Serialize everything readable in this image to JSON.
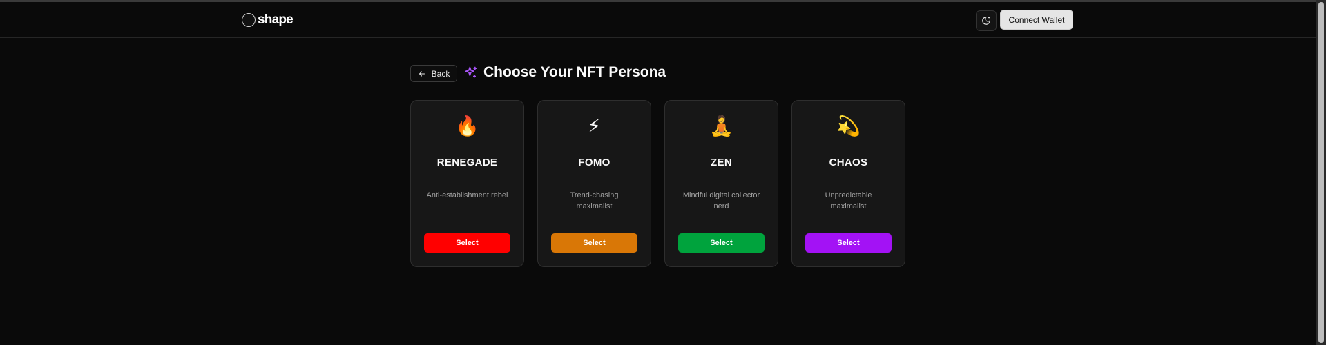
{
  "header": {
    "logo_text": "shape",
    "theme_toggle_icon": "moon-sun-icon",
    "connect_label": "Connect Wallet"
  },
  "nav": {
    "back_label": "Back",
    "back_icon": "arrow-left-icon"
  },
  "page": {
    "title_icon": "sparkles-icon",
    "title": "Choose Your NFT Persona"
  },
  "personas": [
    {
      "emoji": "🔥",
      "name": "RENEGADE",
      "description": "Anti-establishment rebel",
      "button_label": "Select",
      "color": "#ff0000"
    },
    {
      "emoji": "⚡",
      "name": "FOMO",
      "description": "Trend-chasing maximalist",
      "button_label": "Select",
      "color": "#d97706"
    },
    {
      "emoji": "🧘",
      "name": "ZEN",
      "description": "Mindful digital collector nerd",
      "button_label": "Select",
      "color": "#00a33d"
    },
    {
      "emoji": "💫",
      "name": "CHAOS",
      "description": "Unpredictable maximalist",
      "button_label": "Select",
      "color": "#a312f5"
    }
  ],
  "colors": {
    "background": "#0a0a0a",
    "card": "#171717",
    "accent_purple": "#a855f7"
  }
}
